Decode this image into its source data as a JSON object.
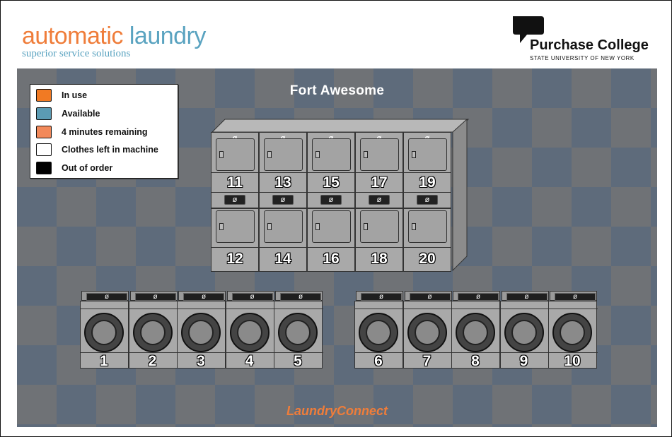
{
  "header": {
    "left_logo": {
      "word1": "automatic",
      "word2": "laundry",
      "tagline": "superior service solutions"
    },
    "right_logo": {
      "name": "Purchase College",
      "subtitle": "STATE UNIVERSITY OF NEW YORK",
      "icon": "purchase-college-mark"
    }
  },
  "room": {
    "title": "Fort Awesome",
    "footer_brand": "LaundryConnect"
  },
  "legend": {
    "items": [
      {
        "label": "In use",
        "color": "#f17a23"
      },
      {
        "label": "Available",
        "color": "#5b9bb3"
      },
      {
        "label": "4 minutes remaining",
        "color": "#f2895a"
      },
      {
        "label": "Clothes left in machine",
        "color": "#ffffff"
      },
      {
        "label": "Out of order",
        "color": "#000000"
      }
    ]
  },
  "dryers_top": [
    {
      "number": "11",
      "status_symbol": "ø"
    },
    {
      "number": "13",
      "status_symbol": "ø"
    },
    {
      "number": "15",
      "status_symbol": "ø"
    },
    {
      "number": "17",
      "status_symbol": "ø"
    },
    {
      "number": "19",
      "status_symbol": "ø"
    }
  ],
  "dryers_bottom": [
    {
      "number": "12",
      "status_symbol": "ø"
    },
    {
      "number": "14",
      "status_symbol": "ø"
    },
    {
      "number": "16",
      "status_symbol": "ø"
    },
    {
      "number": "18",
      "status_symbol": "ø"
    },
    {
      "number": "20",
      "status_symbol": "ø"
    }
  ],
  "washers_left": [
    {
      "number": "1",
      "status_symbol": "ø"
    },
    {
      "number": "2",
      "status_symbol": "ø"
    },
    {
      "number": "3",
      "status_symbol": "ø"
    },
    {
      "number": "4",
      "status_symbol": "ø"
    },
    {
      "number": "5",
      "status_symbol": "ø"
    }
  ],
  "washers_right": [
    {
      "number": "6",
      "status_symbol": "ø"
    },
    {
      "number": "7",
      "status_symbol": "ø"
    },
    {
      "number": "8",
      "status_symbol": "ø"
    },
    {
      "number": "9",
      "status_symbol": "ø"
    },
    {
      "number": "10",
      "status_symbol": "ø"
    }
  ]
}
